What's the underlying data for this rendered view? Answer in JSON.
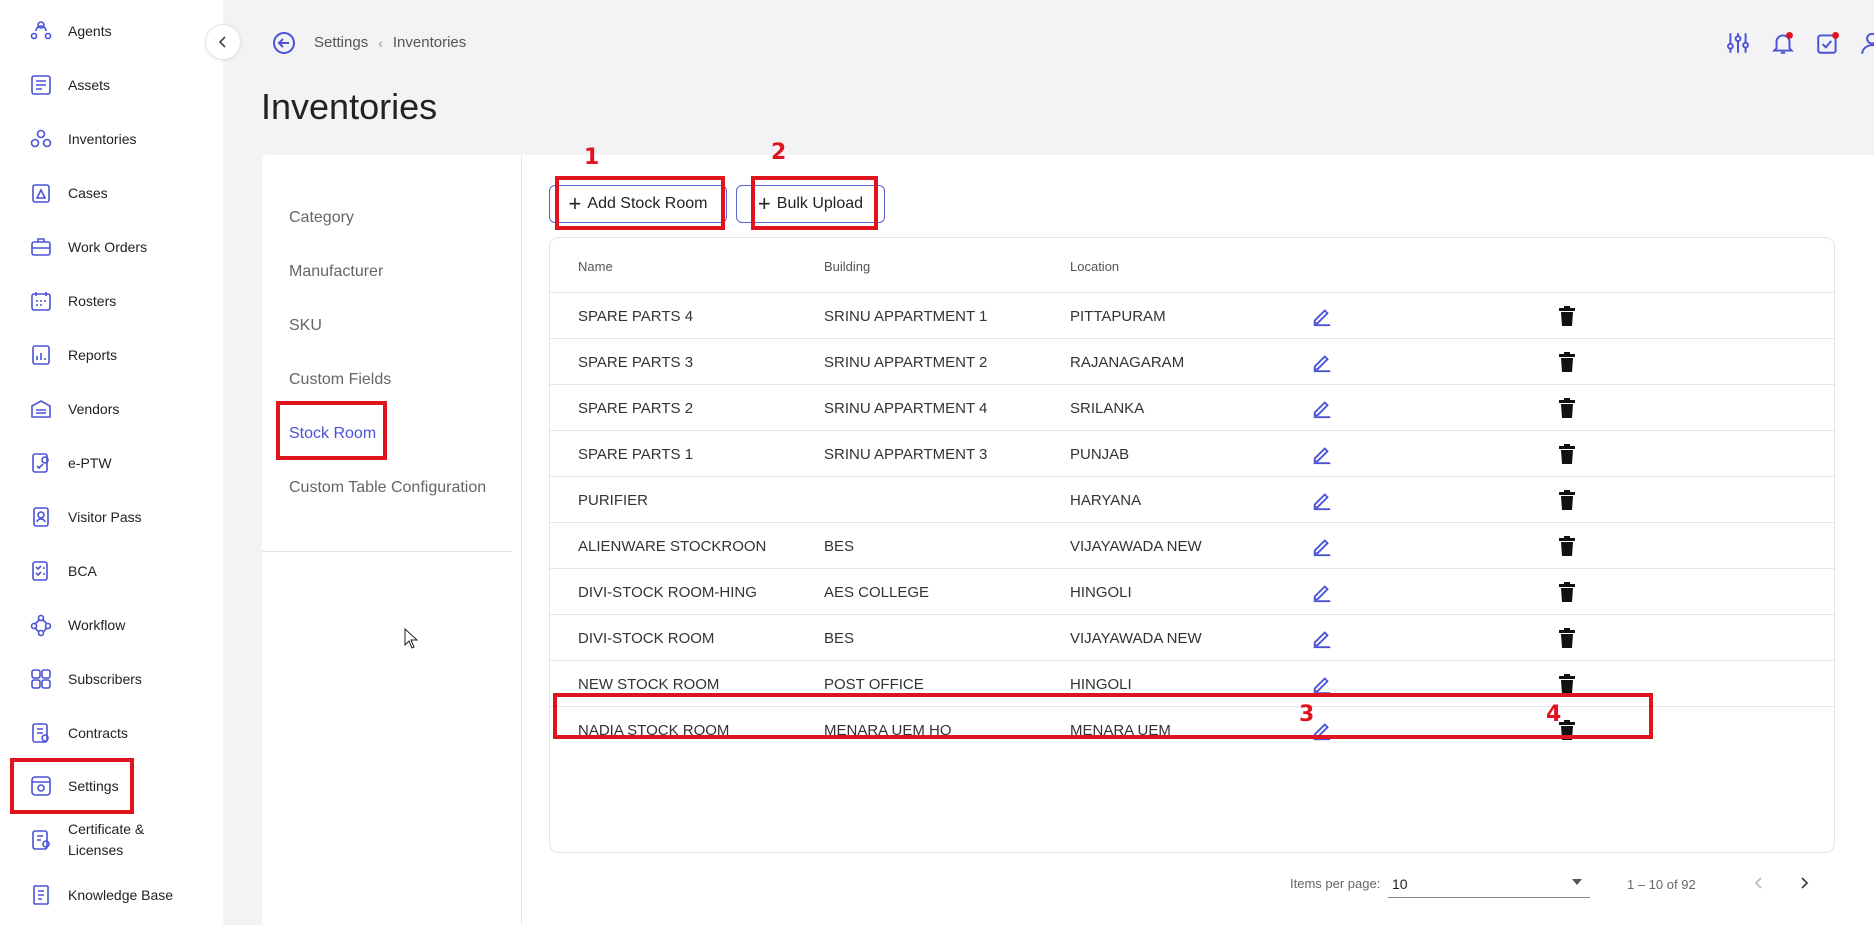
{
  "sidebar": {
    "items": [
      {
        "label": "Agents",
        "icon": "agents-icon"
      },
      {
        "label": "Assets",
        "icon": "assets-icon"
      },
      {
        "label": "Inventories",
        "icon": "inventories-icon"
      },
      {
        "label": "Cases",
        "icon": "cases-icon"
      },
      {
        "label": "Work Orders",
        "icon": "work-orders-icon"
      },
      {
        "label": "Rosters",
        "icon": "rosters-icon"
      },
      {
        "label": "Reports",
        "icon": "reports-icon"
      },
      {
        "label": "Vendors",
        "icon": "vendors-icon"
      },
      {
        "label": "e-PTW",
        "icon": "eptw-icon"
      },
      {
        "label": "Visitor Pass",
        "icon": "visitor-pass-icon"
      },
      {
        "label": "BCA",
        "icon": "bca-icon"
      },
      {
        "label": "Workflow",
        "icon": "workflow-icon"
      },
      {
        "label": "Subscribers",
        "icon": "subscribers-icon"
      },
      {
        "label": "Contracts",
        "icon": "contracts-icon"
      },
      {
        "label": "Settings",
        "icon": "settings-icon"
      },
      {
        "label": "Certificate & Licenses",
        "icon": "certificate-icon"
      },
      {
        "label": "Knowledge Base",
        "icon": "knowledge-base-icon"
      }
    ]
  },
  "header": {
    "breadcrumb": [
      "Settings",
      "Inventories"
    ],
    "title": "Inventories",
    "icons": [
      "filter-sliders-icon",
      "notification-bell-icon",
      "task-calendar-icon",
      "user-profile-icon"
    ]
  },
  "settings_nav": {
    "items": [
      "Category",
      "Manufacturer",
      "SKU",
      "Custom Fields",
      "Stock Room",
      "Custom Table Configuration"
    ],
    "active": "Stock Room"
  },
  "toolbar": {
    "add_label": "Add Stock Room",
    "bulk_label": "Bulk Upload"
  },
  "table": {
    "columns": [
      "Name",
      "Building",
      "Location"
    ],
    "rows": [
      {
        "name": "SPARE PARTS 4",
        "building": "SRINU APPARTMENT 1",
        "location": "PITTAPURAM"
      },
      {
        "name": "SPARE PARTS 3",
        "building": "SRINU APPARTMENT 2",
        "location": "RAJANAGARAM"
      },
      {
        "name": "SPARE PARTS 2",
        "building": "SRINU APPARTMENT 4",
        "location": "SRILANKA"
      },
      {
        "name": "SPARE PARTS 1",
        "building": "SRINU APPARTMENT 3",
        "location": "PUNJAB"
      },
      {
        "name": "PURIFIER",
        "building": "",
        "location": "HARYANA"
      },
      {
        "name": "ALIENWARE STOCKROON",
        "building": "BES",
        "location": "VIJAYAWADA NEW"
      },
      {
        "name": "DIVI-STOCK ROOM-HING",
        "building": "AES COLLEGE",
        "location": "HINGOLI"
      },
      {
        "name": "DIVI-STOCK ROOM",
        "building": "BES",
        "location": "VIJAYAWADA NEW"
      },
      {
        "name": "NEW STOCK ROOM",
        "building": "POST OFFICE",
        "location": "HINGOLI"
      },
      {
        "name": "NADIA STOCK ROOM",
        "building": "MENARA UEM HQ",
        "location": "MENARA UEM"
      }
    ]
  },
  "pagination": {
    "items_per_page_label": "Items per page:",
    "items_per_page": "10",
    "range": "1 – 10 of 92"
  },
  "annotations": {
    "labels": [
      "1",
      "2",
      "3",
      "4"
    ],
    "color": "#e0141f"
  },
  "colors": {
    "accent": "#4a52d6",
    "annotation": "#e0141f"
  }
}
